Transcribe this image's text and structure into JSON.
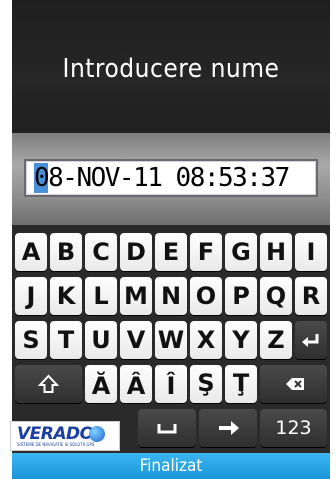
{
  "header": {
    "title": "Introducere nume"
  },
  "input": {
    "cursor_char": "0",
    "rest_text": "8-NOV-11 08:53:37"
  },
  "keyboard": {
    "row1": [
      "A",
      "B",
      "C",
      "D",
      "E",
      "F",
      "G",
      "H",
      "I"
    ],
    "row2": [
      "J",
      "K",
      "L",
      "M",
      "N",
      "O",
      "P",
      "Q",
      "R"
    ],
    "row3": [
      "S",
      "T",
      "U",
      "V",
      "W",
      "X",
      "Y",
      "Z"
    ],
    "row4": [
      "Ă",
      "Â",
      "Î",
      "Ş",
      "Ţ"
    ],
    "numbers_label": "123",
    "enter_icon": "enter-icon",
    "shift_icon": "shift-icon",
    "backspace_icon": "backspace-icon",
    "space_icon": "space-icon",
    "arrow_icon": "right-arrow-icon"
  },
  "logo": {
    "text": "VERADO",
    "subtext": "SISTEME DE NAVIGATIE SI SOLUTII GPS"
  },
  "footer": {
    "done_label": "Finalizat"
  },
  "colors": {
    "footer": "#1996d8",
    "cursor": "#4a90d9",
    "key": "#ffffff",
    "key_dark": "#3a3a3a"
  }
}
